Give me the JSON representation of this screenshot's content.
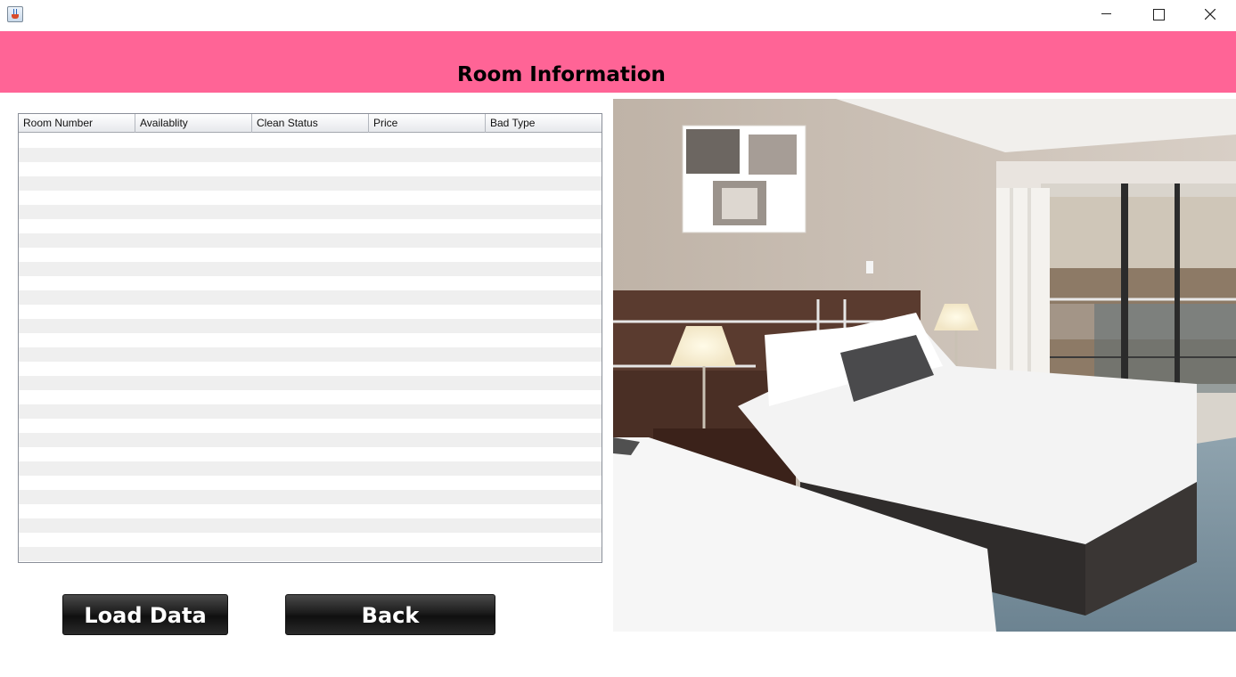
{
  "window": {
    "app_icon": "java-cup-icon",
    "controls": [
      "minimize-icon",
      "maximize-icon",
      "close-icon"
    ]
  },
  "header": {
    "title": "Room Information",
    "color": "#ff6496"
  },
  "table": {
    "columns": [
      "Room Number",
      "Availablity",
      "Clean Status",
      "Price",
      "Bad Type"
    ],
    "rows": []
  },
  "buttons": {
    "load_label": "Load Data",
    "back_label": "Back"
  }
}
